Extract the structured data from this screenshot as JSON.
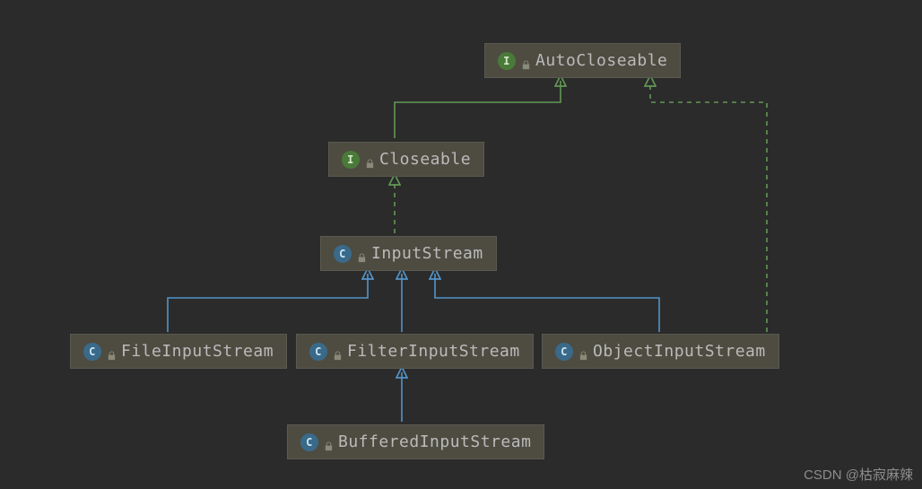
{
  "diagram": {
    "nodes": {
      "autocloseable": {
        "label": "AutoCloseable",
        "kind": "interface"
      },
      "closeable": {
        "label": "Closeable",
        "kind": "interface"
      },
      "inputstream": {
        "label": "InputStream",
        "kind": "abstract-class"
      },
      "fileinputstream": {
        "label": "FileInputStream",
        "kind": "class"
      },
      "filterinputstream": {
        "label": "FilterInputStream",
        "kind": "class"
      },
      "objectinputstream": {
        "label": "ObjectInputStream",
        "kind": "class"
      },
      "bufferedinputstream": {
        "label": "BufferedInputStream",
        "kind": "class"
      }
    },
    "edges": [
      {
        "from": "closeable",
        "to": "autocloseable",
        "style": "solid",
        "color": "green"
      },
      {
        "from": "inputstream",
        "to": "closeable",
        "style": "dashed",
        "color": "green"
      },
      {
        "from": "fileinputstream",
        "to": "inputstream",
        "style": "solid",
        "color": "blue"
      },
      {
        "from": "filterinputstream",
        "to": "inputstream",
        "style": "solid",
        "color": "blue"
      },
      {
        "from": "objectinputstream",
        "to": "inputstream",
        "style": "solid",
        "color": "blue"
      },
      {
        "from": "objectinputstream",
        "to": "autocloseable",
        "style": "dashed",
        "color": "green"
      },
      {
        "from": "bufferedinputstream",
        "to": "filterinputstream",
        "style": "solid",
        "color": "blue"
      }
    ]
  },
  "colors": {
    "green": "#629755",
    "blue": "#5394c9"
  },
  "watermark": "CSDN @枯寂麻辣"
}
